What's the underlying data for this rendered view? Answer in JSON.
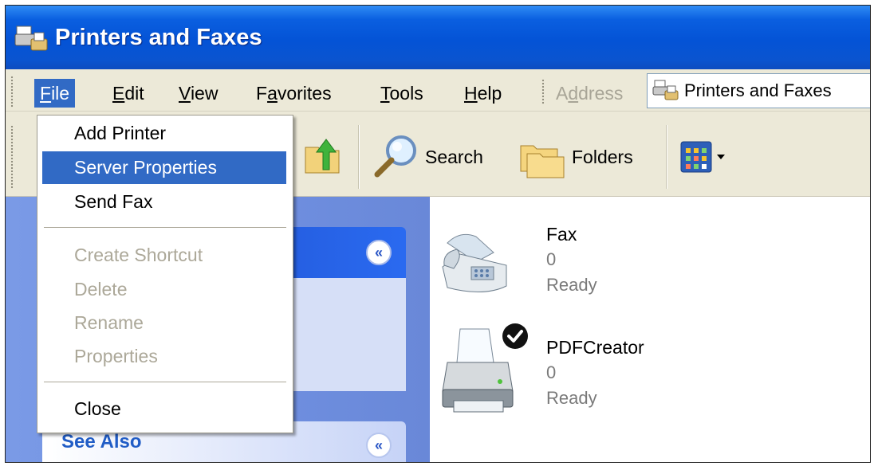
{
  "window": {
    "title": "Printers and Faxes"
  },
  "menubar": {
    "items": [
      {
        "label": "File",
        "accel": "F",
        "rest": "ile"
      },
      {
        "label": "Edit",
        "accel": "E",
        "rest": "dit"
      },
      {
        "label": "View",
        "accel": "V",
        "rest": "iew"
      },
      {
        "label": "Favorites",
        "pre": "F",
        "accel": "a",
        "rest": "vorites"
      },
      {
        "label": "Tools",
        "accel": "T",
        "rest": "ools"
      },
      {
        "label": "Help",
        "accel": "H",
        "rest": "elp"
      }
    ],
    "address_label_pre": "A",
    "address_label_accel": "d",
    "address_label_rest": "dress",
    "address_value": "Printers and Faxes"
  },
  "toolbar": {
    "search_label": "Search",
    "folders_label": "Folders"
  },
  "file_menu": {
    "items": [
      {
        "label": "Add Printer",
        "state": "normal"
      },
      {
        "label": "Server Properties",
        "state": "selected"
      },
      {
        "label": "Send Fax",
        "state": "normal"
      },
      {
        "label": "Create Shortcut",
        "state": "disabled"
      },
      {
        "label": "Delete",
        "state": "disabled"
      },
      {
        "label": "Rename",
        "state": "disabled"
      },
      {
        "label": "Properties",
        "state": "disabled"
      },
      {
        "label": "Close",
        "state": "normal"
      }
    ]
  },
  "left_pane": {
    "see_also_title": "See Also"
  },
  "printers": [
    {
      "name": "Fax",
      "documents": "0",
      "status": "Ready",
      "icon": "fax-icon"
    },
    {
      "name": "PDFCreator",
      "documents": "0",
      "status": "Ready",
      "icon": "printer-icon",
      "default": true
    }
  ],
  "colors": {
    "titlebar": "#0453d6",
    "menu_highlight": "#316ac5",
    "chrome": "#ece9d8",
    "taskpane": "#7a9ae6",
    "see_also": "#215dc6"
  }
}
